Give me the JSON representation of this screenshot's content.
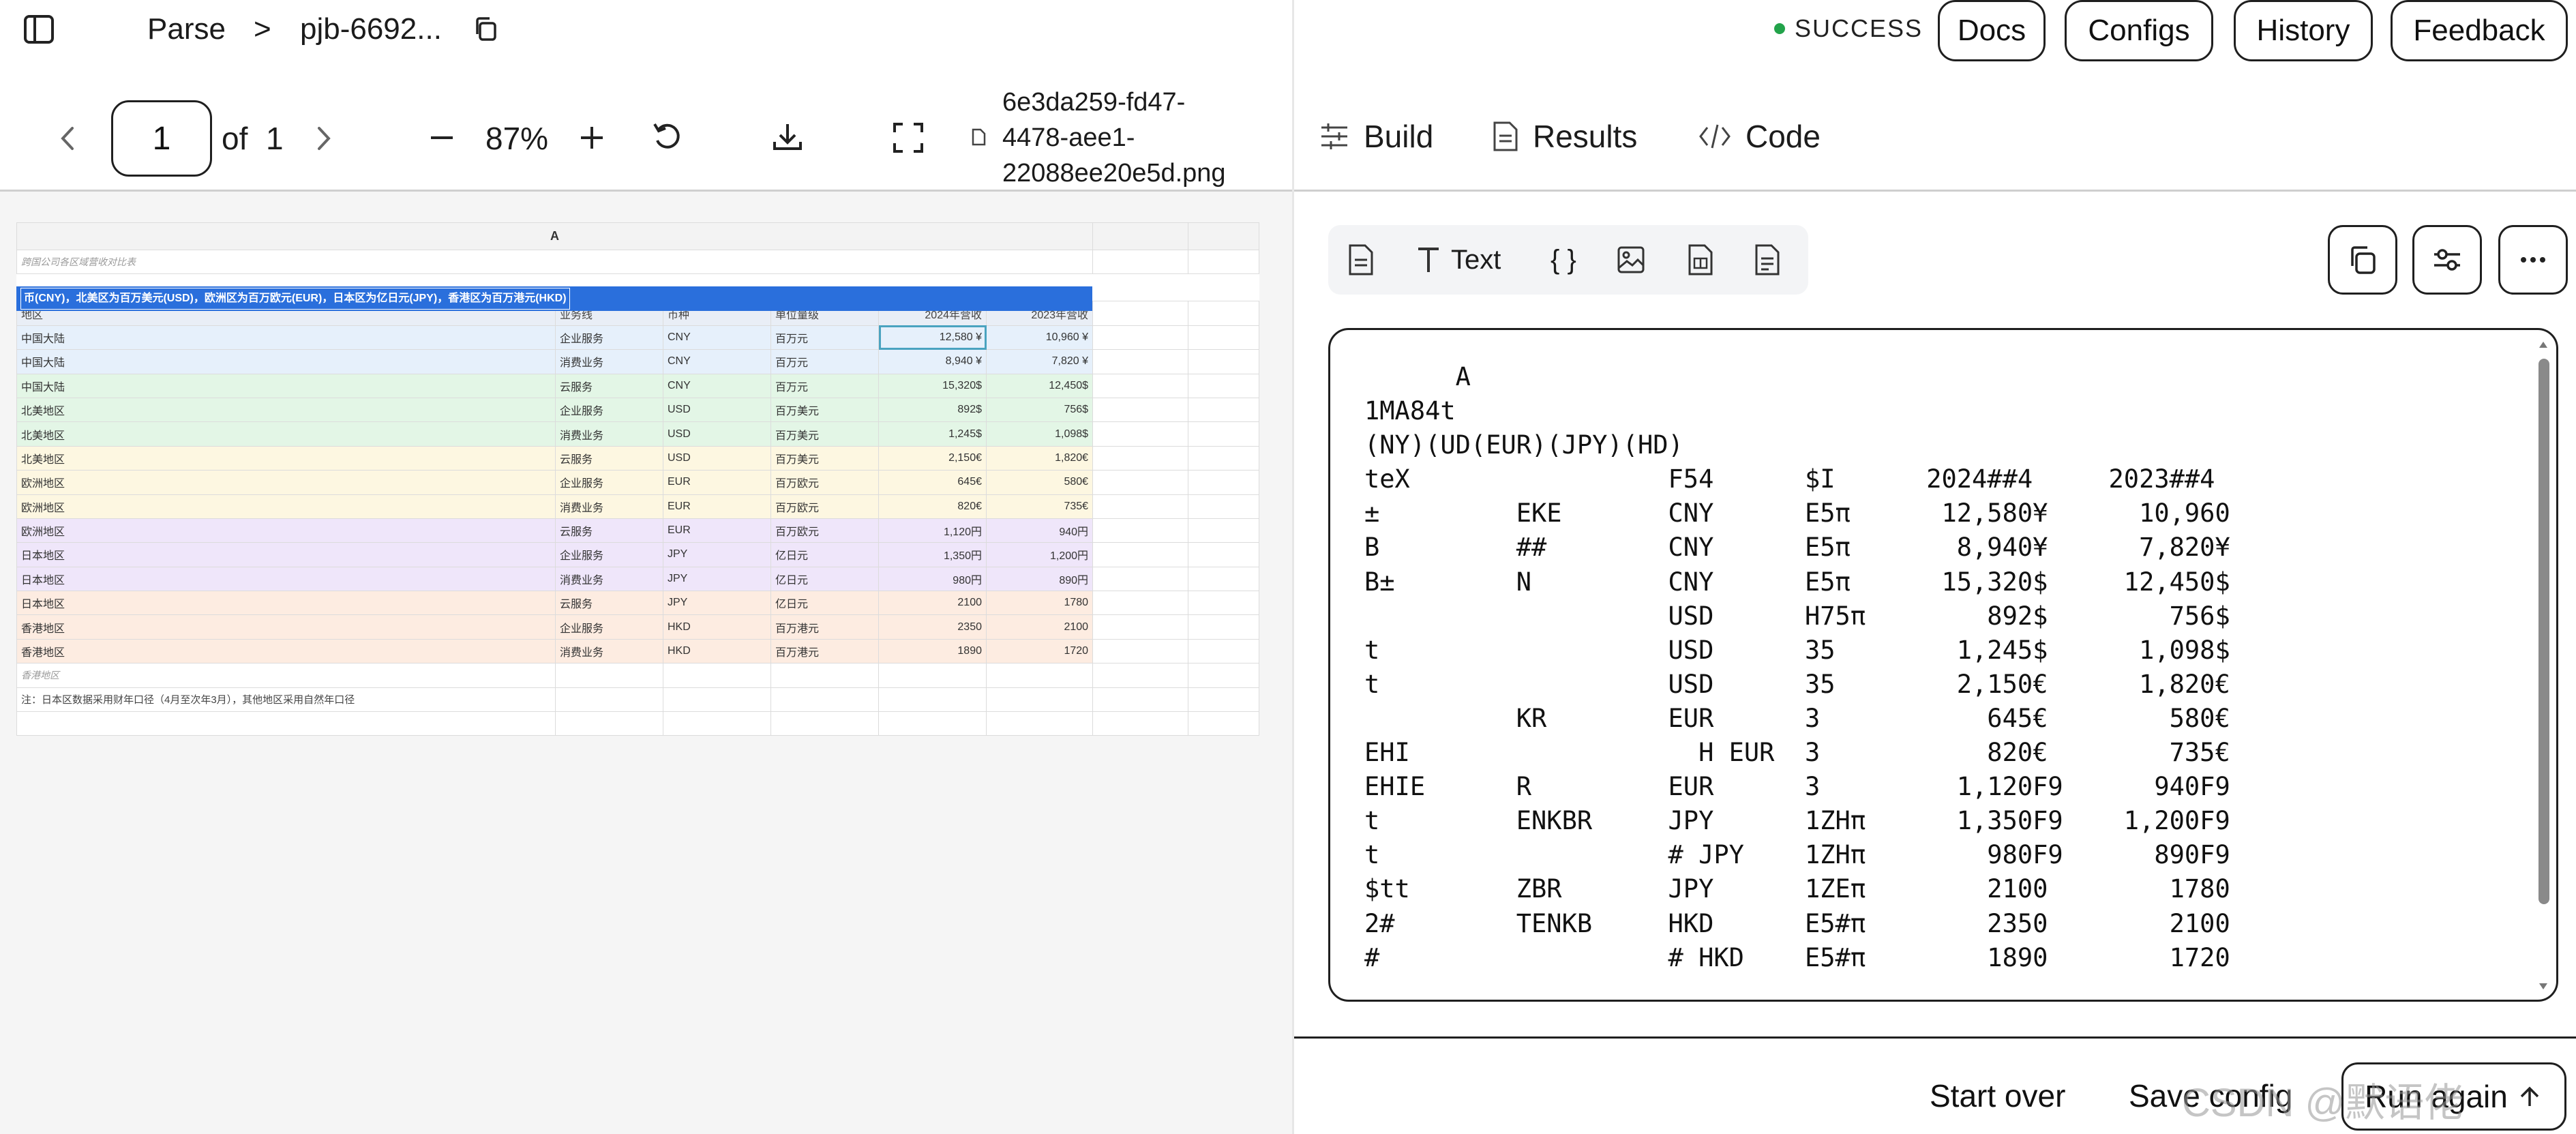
{
  "header": {
    "breadcrumb_parse": "Parse",
    "breadcrumb_sep": ">",
    "breadcrumb_job": "pjb-6692...",
    "status": "SUCCESS",
    "status_color": "#22a34a",
    "buttons": {
      "docs": "Docs",
      "configs": "Configs",
      "history": "History",
      "feedback": "Feedback"
    }
  },
  "viewer": {
    "page_value": "1",
    "page_of": "of",
    "page_total": "1",
    "zoom": "87%",
    "filename_lines": [
      "6e3da259-fd47-",
      "4478-aee1-",
      "22088ee20e5d.png"
    ]
  },
  "sheet": {
    "column_letter": "A",
    "title": "跨国公司各区域营收对比表",
    "banner": "币(CNY)，北美区为百万美元(USD)，欧洲区为百万欧元(EUR)，日本区为亿日元(JPY)，香港区为百万港元(HKD)",
    "headers": [
      "地区",
      "业务线",
      "币种",
      "单位量级",
      "2024年营收",
      "2023年营收"
    ],
    "rows": [
      {
        "cells": [
          "中国大陆",
          "企业服务",
          "CNY",
          "百万元",
          "12,580 ¥",
          "10,960 ¥"
        ],
        "color": "#e6f0fb"
      },
      {
        "cells": [
          "中国大陆",
          "消费业务",
          "CNY",
          "百万元",
          "8,940 ¥",
          "7,820 ¥"
        ],
        "color": "#e6f0fb"
      },
      {
        "cells": [
          "中国大陆",
          "云服务",
          "CNY",
          "百万元",
          "15,320$",
          "12,450$"
        ],
        "color": "#e3f6e6"
      },
      {
        "cells": [
          "北美地区",
          "企业服务",
          "USD",
          "百万美元",
          "892$",
          "756$"
        ],
        "color": "#e3f6e6"
      },
      {
        "cells": [
          "北美地区",
          "消费业务",
          "USD",
          "百万美元",
          "1,245$",
          "1,098$"
        ],
        "color": "#e3f6e6"
      },
      {
        "cells": [
          "北美地区",
          "云服务",
          "USD",
          "百万美元",
          "2,150€",
          "1,820€"
        ],
        "color": "#fdf7e1"
      },
      {
        "cells": [
          "欧洲地区",
          "企业服务",
          "EUR",
          "百万欧元",
          "645€",
          "580€"
        ],
        "color": "#fdf7e1"
      },
      {
        "cells": [
          "欧洲地区",
          "消费业务",
          "EUR",
          "百万欧元",
          "820€",
          "735€"
        ],
        "color": "#fdf7e1"
      },
      {
        "cells": [
          "欧洲地区",
          "云服务",
          "EUR",
          "百万欧元",
          "1,120円",
          "940円"
        ],
        "color": "#efe6fa"
      },
      {
        "cells": [
          "日本地区",
          "企业服务",
          "JPY",
          "亿日元",
          "1,350円",
          "1,200円"
        ],
        "color": "#efe6fa"
      },
      {
        "cells": [
          "日本地区",
          "消费业务",
          "JPY",
          "亿日元",
          "980円",
          "890円"
        ],
        "color": "#efe6fa"
      },
      {
        "cells": [
          "日本地区",
          "云服务",
          "JPY",
          "亿日元",
          "2100",
          "1780"
        ],
        "color": "#fdece1"
      },
      {
        "cells": [
          "香港地区",
          "企业服务",
          "HKD",
          "百万港元",
          "2350",
          "2100"
        ],
        "color": "#fdece1"
      },
      {
        "cells": [
          "香港地区",
          "消费业务",
          "HKD",
          "百万港元",
          "1890",
          "1720"
        ],
        "color": "#fdece1"
      }
    ],
    "footer_row": "香港地区",
    "note": "注：日本区数据采用财年口径（4月至次年3月），其他地区采用自然年口径"
  },
  "tabs": {
    "build": "Build",
    "results": "Results",
    "code": "Code"
  },
  "format_bar": {
    "text_label": "Text",
    "braces_label": "{ }"
  },
  "code_output": [
    "      A",
    "1MA84t",
    "(NY)(UD(EUR)(JPY)(HD)",
    "teX                 F54      $I      2024##4     2023##4",
    "±         EKE       CNY      E5π      12,580¥      10,960",
    "B         ##        CNY      E5π       8,940¥      7,820¥",
    "B±        N         CNY      E5π      15,320$     12,450$",
    "                    USD      H75π        892$        756$",
    "t                   USD      35        1,245$      1,098$",
    "t                   USD      35        2,150€      1,820€",
    "          KR        EUR      3           645€        580€",
    "EHI                   H EUR  3           820€        735€",
    "EHIE      R         EUR      3         1,120F9      940F9",
    "t         ENKBR     JPY      1ZHπ      1,350F9    1,200F9",
    "t                   # JPY    1ZHπ        980F9      890F9",
    "$tt       ZBR       JPY      1ZEπ        2100        1780",
    "2#        TENKB     HKD      E5#π        2350        2100",
    "#                   # HKD    E5#π        1890        1720"
  ],
  "footer": {
    "start_over": "Start over",
    "save_config": "Save config",
    "run_again": "Run again"
  },
  "watermark": "CSDN @默语佬"
}
